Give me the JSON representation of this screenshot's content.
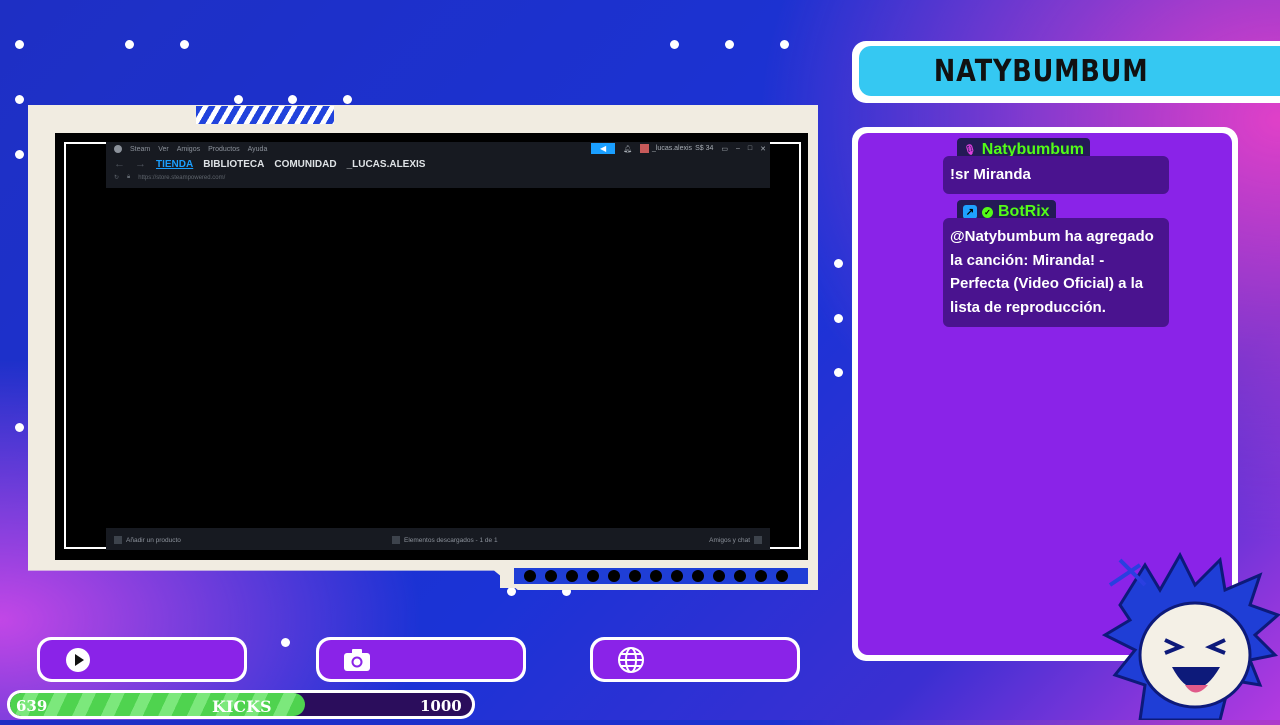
{
  "steam": {
    "menu": [
      "Steam",
      "Ver",
      "Amigos",
      "Productos",
      "Ayuda"
    ],
    "tabs": [
      "TIENDA",
      "BIBLIOTECA",
      "COMUNIDAD",
      "_LUCAS.ALEXIS"
    ],
    "url": "https://store.steampowered.com/",
    "user_name": "_lucas.alexis",
    "balance": "S$ 34",
    "footer_add": "Añadir un producto",
    "footer_downloads": "Elementos descargados - 1 de 1",
    "footer_friends": "Amigos y chat"
  },
  "stream": {
    "channel_name": "NATYBUMBUM"
  },
  "chat": {
    "messages": [
      {
        "user": "Natybumbum",
        "text": "!sr Miranda"
      },
      {
        "user": "BotRix",
        "text": "@Natybumbum ha agregado la canción: Miranda! - Perfecta (Video Oficial) a la lista de reproducción."
      }
    ]
  },
  "buttons": {
    "play_icon": "play-icon",
    "camera_icon": "camera-icon",
    "globe_icon": "globe-icon"
  },
  "goal": {
    "current": "639",
    "label": "KICKS",
    "target": "1000",
    "progress": 0.639
  },
  "colors": {
    "kick_green": "#53fc18",
    "accent_purple": "#8a23e8",
    "banner_cyan": "#35c8f2"
  }
}
